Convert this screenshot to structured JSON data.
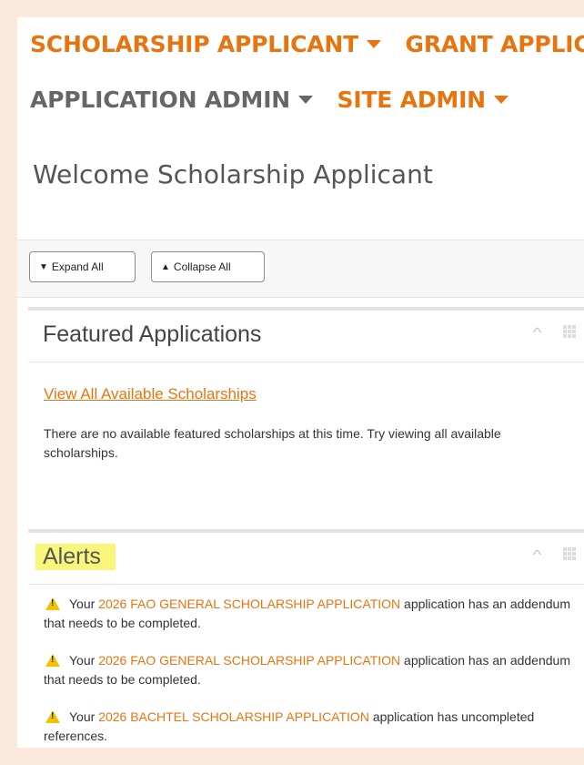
{
  "nav": {
    "row1": [
      {
        "label": "SCHOLARSHIP APPLICANT",
        "color": "#e8740f",
        "caret": true
      },
      {
        "label": "GRANT APPLICANT",
        "color": "#e8740f",
        "caret": true
      }
    ],
    "row2": [
      {
        "label": "APPLICATION ADMIN",
        "color": "#666666",
        "caret": true
      },
      {
        "label": "SITE ADMIN",
        "color": "#e8740f",
        "caret": true
      }
    ]
  },
  "welcome": "Welcome Scholarship Applicant",
  "toolbar": {
    "expand_label": "Expand All",
    "collapse_label": "Collapse All",
    "expand_icon": "chevron-down-icon",
    "collapse_icon": "chevron-up-icon"
  },
  "featured": {
    "title": "Featured Applications",
    "link": "View All Available Scholarships",
    "text": "There are no available featured scholarships at this time. Try viewing all available scholarships."
  },
  "alerts": {
    "title": "Alerts",
    "items": [
      {
        "prefix": "Your ",
        "link": "2026 FAO GENERAL SCHOLARSHIP APPLICATION",
        "suffix": " application has an addendum that needs to be completed."
      },
      {
        "prefix": "Your ",
        "link": "2026 FAO GENERAL SCHOLARSHIP APPLICATION",
        "suffix": " application has an addendum that needs to be completed."
      },
      {
        "prefix": "Your ",
        "link": "2026 BACHTEL SCHOLARSHIP APPLICATION",
        "suffix": " application has uncompleted references."
      }
    ]
  },
  "colors": {
    "accent": "#e8740f",
    "highlight": "#f8f77b",
    "page_bg": "#fce9dd"
  }
}
